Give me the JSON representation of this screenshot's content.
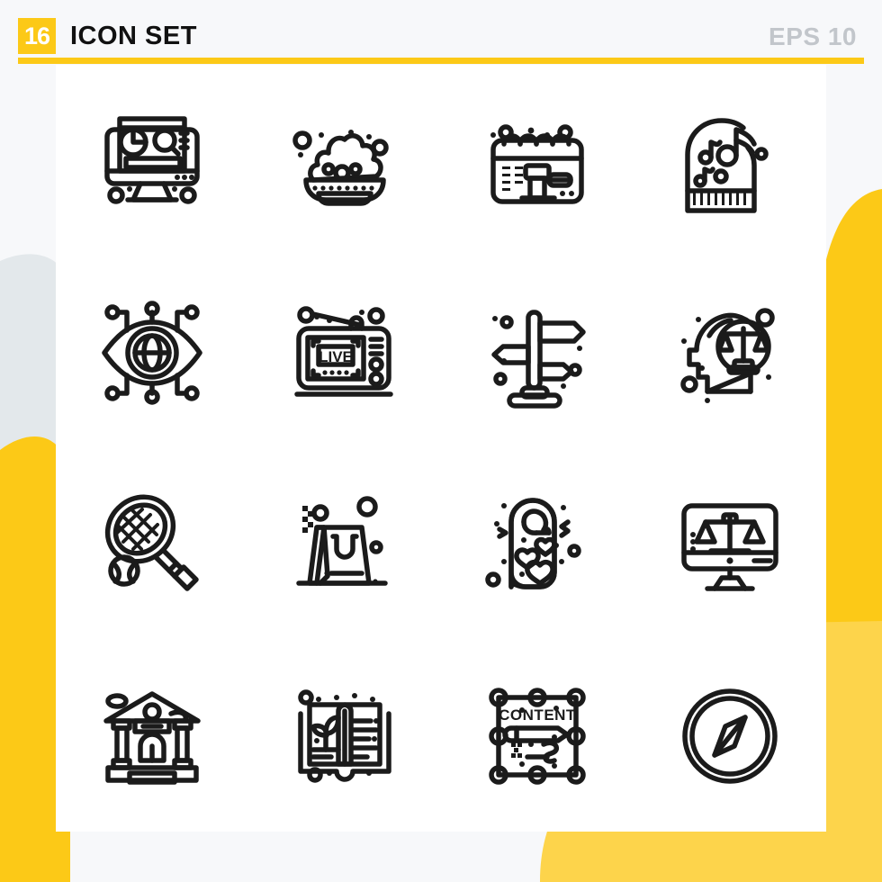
{
  "header": {
    "count_badge": "16",
    "title": "ICON SET",
    "format_label": "EPS 10"
  },
  "colors": {
    "accent_yellow": "#FCC917",
    "accent_yellow_light": "#FDD44B",
    "decor_gray": "#E3E8EB",
    "page_background": "#F7F8FA",
    "card_background": "#FFFFFF",
    "icon_stroke": "#1B1B1B",
    "eps_label_gray": "#C2C6CB"
  },
  "grid": {
    "columns": 4,
    "rows": 4,
    "total_icons": 16
  },
  "icons": [
    {
      "position": 1,
      "row": 1,
      "col": 1,
      "name": "seo-analytics-monitor-icon",
      "label": "SEO analytics monitor"
    },
    {
      "position": 2,
      "row": 1,
      "col": 2,
      "name": "foam-bowl-icon",
      "label": "Bowl of foam with bubbles"
    },
    {
      "position": 3,
      "row": 1,
      "col": 3,
      "name": "court-date-calendar-icon",
      "label": "Calendar with gavel"
    },
    {
      "position": 4,
      "row": 1,
      "col": 4,
      "name": "grand-piano-icon",
      "label": "Grand piano with music notes"
    },
    {
      "position": 5,
      "row": 2,
      "col": 1,
      "name": "global-vision-eye-icon",
      "label": "Eye with globe and network nodes"
    },
    {
      "position": 6,
      "row": 2,
      "col": 2,
      "name": "live-television-icon",
      "label": "Retro TV broadcasting LIVE",
      "screen_text": "LIVE"
    },
    {
      "position": 7,
      "row": 2,
      "col": 3,
      "name": "signpost-directions-icon",
      "label": "Directional signpost"
    },
    {
      "position": 8,
      "row": 2,
      "col": 4,
      "name": "legal-mind-head-icon",
      "label": "Head with justice scale"
    },
    {
      "position": 9,
      "row": 3,
      "col": 1,
      "name": "tennis-racket-icon",
      "label": "Tennis racket and ball"
    },
    {
      "position": 10,
      "row": 3,
      "col": 2,
      "name": "shopping-bag-icon",
      "label": "Shopping bag"
    },
    {
      "position": 11,
      "row": 3,
      "col": 3,
      "name": "door-hanger-hearts-icon",
      "label": "Door hanger with hearts"
    },
    {
      "position": 12,
      "row": 3,
      "col": 4,
      "name": "online-law-monitor-icon",
      "label": "Monitor with justice scale"
    },
    {
      "position": 13,
      "row": 4,
      "col": 1,
      "name": "courthouse-building-icon",
      "label": "Courthouse building"
    },
    {
      "position": 14,
      "row": 4,
      "col": 2,
      "name": "book-sprout-icon",
      "label": "Open book with growing plant"
    },
    {
      "position": 15,
      "row": 4,
      "col": 3,
      "name": "content-editing-icon",
      "label": "Content editing frame with pencil",
      "frame_text": "CONTENT"
    },
    {
      "position": 16,
      "row": 4,
      "col": 4,
      "name": "compass-icon",
      "label": "Compass"
    }
  ]
}
